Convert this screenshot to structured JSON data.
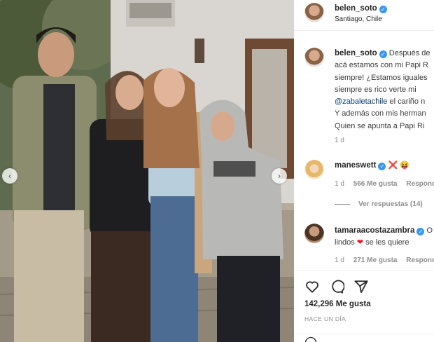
{
  "post": {
    "author": "belen_soto",
    "location": "Santiago, Chile"
  },
  "caption": {
    "username": "belen_soto",
    "lines": [
      "Después de",
      "acá estamos con mi Papi R",
      "siempre! ¿Estamos iguales",
      "siempre es rico verte mi",
      "el cariño n",
      "Y además con mis herman",
      "Quien se apunta a Papi Ri"
    ],
    "mention": "@zabaletachile",
    "age": "1 d"
  },
  "comments": [
    {
      "username": "maneswett",
      "text": "",
      "emojis": [
        "❌",
        "😝"
      ],
      "age": "1 d",
      "likes": "566 Me gusta",
      "reply": "Responder",
      "view_replies": "Ver respuestas (14)"
    },
    {
      "username": "tamaraacostazambra",
      "text_lead": "O",
      "text_line2": "lindos",
      "text_line2_tail": "se les quiere",
      "age": "1 d",
      "likes": "271 Me gusta",
      "reply": "Responder"
    }
  ],
  "actions": {
    "likes_count": "142,296 Me gusta",
    "time_ago": "HACE UN DÍA"
  },
  "colors": {
    "verified": "#3897f0",
    "mention": "#00376b",
    "meta": "#8e8e8e",
    "heart": "#ed1c24"
  },
  "icons": [
    "heart-icon",
    "comment-icon",
    "share-icon",
    "verified-icon",
    "chevron-left-icon",
    "chevron-right-icon"
  ]
}
